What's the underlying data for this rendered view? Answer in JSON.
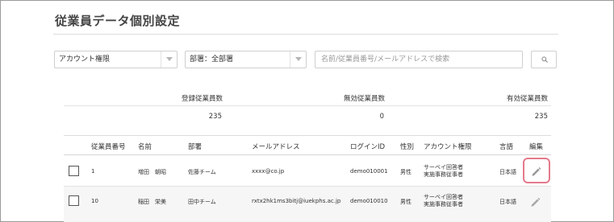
{
  "page": {
    "title": "従業員データ個別設定"
  },
  "filters": {
    "account_select": "アカウント権限",
    "department_select": "部署：全部署",
    "search_placeholder": "名前/従業員番号/メールアドレスで検索"
  },
  "stats": {
    "registered_label": "登録従業員数",
    "registered_value": "235",
    "invalid_label": "無効従業員数",
    "invalid_value": "0",
    "valid_label": "有効従業員数",
    "valid_value": "235"
  },
  "table": {
    "headers": {
      "number": "従業員番号",
      "name": "名前",
      "department": "部署",
      "email": "メールアドレス",
      "login_id": "ログインID",
      "gender": "性別",
      "account_role": "アカウント権限",
      "language": "言語",
      "edit": "編集"
    },
    "rows": [
      {
        "number": "1",
        "name": "増田　朝昭",
        "department": "佐藤チーム",
        "email": "xxxx@co.jp",
        "login_id": "demo010001",
        "gender": "男性",
        "role_line1": "サーベイ回答者",
        "role_line2": "実施事務従事者",
        "language": "日本語"
      },
      {
        "number": "10",
        "name": "稲田　栄美",
        "department": "田中チーム",
        "email": "rxtx2hk1ms3bitj@iuekphs.ac.jp",
        "login_id": "demo010010",
        "gender": "男性",
        "role_line1": "サーベイ回答者",
        "role_line2": "実施事務従事者",
        "language": "日本語"
      }
    ]
  },
  "colors": {
    "highlight": "#e47a8c",
    "pencil": "#9a9a9a"
  },
  "icons": {
    "search": "search-icon",
    "caret": "chevron-down-icon",
    "edit": "pencil-icon"
  }
}
